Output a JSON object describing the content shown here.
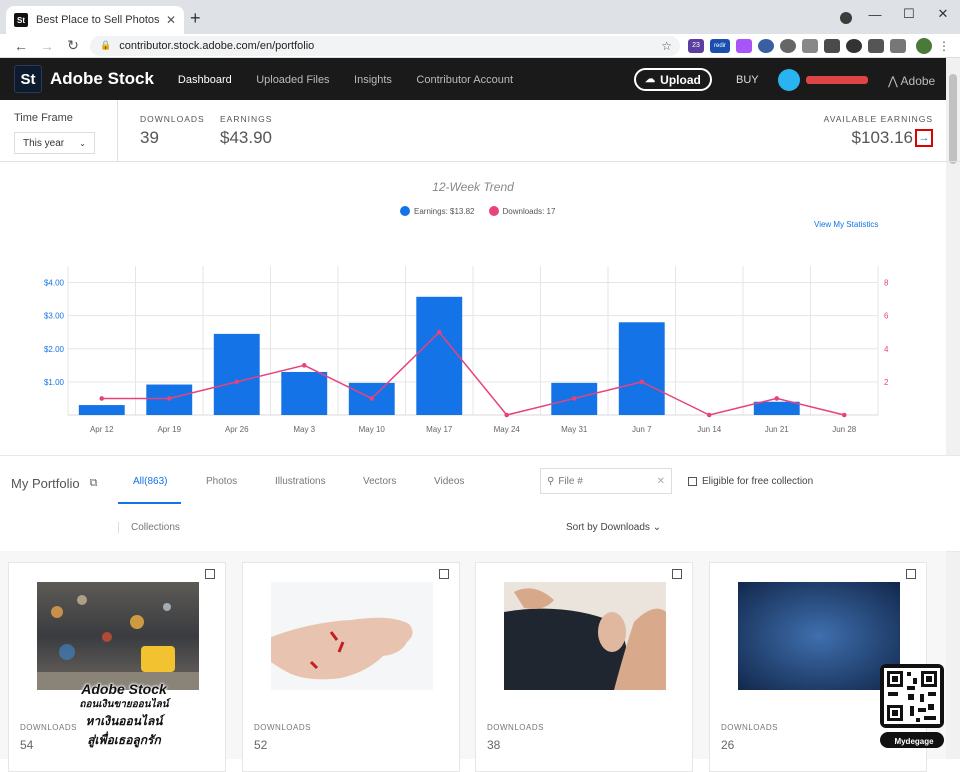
{
  "browser": {
    "tab_title": "Best Place to Sell Photos Online,",
    "tab_favicon": "St",
    "url": "contributor.stock.adobe.com/en/portfolio",
    "ext_badge_1": "23",
    "ext_badge_2": "redir"
  },
  "header": {
    "logo": "St",
    "brand": "Adobe Stock",
    "nav": [
      "Dashboard",
      "Uploaded Files",
      "Insights",
      "Contributor Account"
    ],
    "upload": "Upload",
    "buy": "BUY",
    "adobe": "Adobe"
  },
  "stats": {
    "timeframe_label": "Time Frame",
    "timeframe_value": "This year",
    "downloads_label": "DOWNLOADS",
    "downloads_value": "39",
    "earnings_label": "EARNINGS",
    "earnings_value": "$43.90",
    "available_label": "AVAILABLE EARNINGS",
    "available_value": "$103.16"
  },
  "chart_data": {
    "type": "bar",
    "title": "12-Week Trend",
    "legend": [
      {
        "label": "Earnings: $13.82",
        "color": "#1473e6"
      },
      {
        "label": "Downloads: 17",
        "color": "#e8427c"
      }
    ],
    "view_link": "View My Statistics",
    "categories": [
      "Apr 12",
      "Apr 19",
      "Apr 26",
      "May 3",
      "May 10",
      "May 17",
      "May 24",
      "May 31",
      "Jun 7",
      "Jun 14",
      "Jun 21",
      "Jun 28"
    ],
    "series": [
      {
        "name": "Earnings",
        "type": "bar",
        "axis": "left",
        "color": "#1473e6",
        "values": [
          0.3,
          0.92,
          2.45,
          1.3,
          0.97,
          3.57,
          0,
          0.97,
          2.8,
          0,
          0.4,
          0
        ]
      },
      {
        "name": "Downloads",
        "type": "line",
        "axis": "right",
        "color": "#e8427c",
        "values": [
          1,
          1,
          2,
          3,
          1,
          5,
          0,
          1,
          2,
          0,
          1,
          0
        ]
      }
    ],
    "left_ticks": [
      "$1.00",
      "$2.00",
      "$3.00",
      "$4.00"
    ],
    "right_ticks": [
      "2",
      "4",
      "6",
      "8"
    ],
    "ylim_left": [
      0,
      4.5
    ],
    "ylim_right": [
      0,
      9
    ],
    "grid": true
  },
  "portfolio": {
    "title": "My Portfolio",
    "tabs": [
      "All(863)",
      "Photos",
      "Illustrations",
      "Vectors",
      "Videos"
    ],
    "file_placeholder": "File #",
    "eligible": "Eligible for free collection",
    "collections": "Collections",
    "sort": "Sort by Downloads",
    "cards": [
      {
        "label": "DOWNLOADS",
        "count": "54"
      },
      {
        "label": "DOWNLOADS",
        "count": "52"
      },
      {
        "label": "DOWNLOADS",
        "count": "38"
      },
      {
        "label": "DOWNLOADS",
        "count": "26"
      }
    ]
  },
  "overlay": {
    "line1": "Adobe Stock",
    "line2": "ถอนเงินขายออนไลน์",
    "line3": "หาเงินออนไลน์",
    "line4": "สู่เพื่อเธอลูกรัก",
    "qr_caption": "Mydegage"
  }
}
